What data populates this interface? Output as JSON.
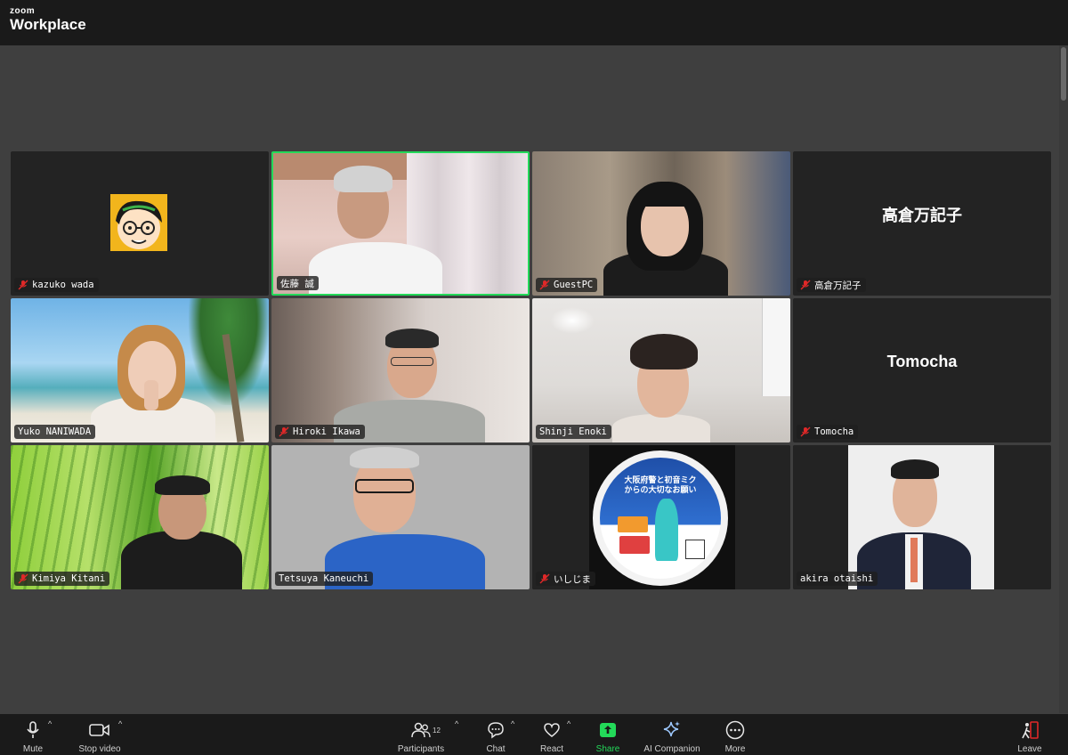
{
  "window": {
    "brand_small": "zoom",
    "brand_big": "Workplace"
  },
  "participants": [
    {
      "name": "kazuko wada",
      "muted": true,
      "video": "avatar"
    },
    {
      "name": "佐藤 誠",
      "muted": false,
      "video": "camera",
      "active_speaker": true
    },
    {
      "name": "GuestPC",
      "muted": true,
      "video": "camera"
    },
    {
      "name": "高倉万記子",
      "muted": true,
      "video": "off"
    },
    {
      "name": "Yuko NANIWADA",
      "muted": false,
      "video": "camera"
    },
    {
      "name": "Hiroki Ikawa",
      "muted": true,
      "video": "camera"
    },
    {
      "name": "Shinji Enoki",
      "muted": false,
      "video": "camera"
    },
    {
      "name": "Tomocha",
      "muted": true,
      "video": "off"
    },
    {
      "name": "Kimiya Kitani",
      "muted": true,
      "video": "camera"
    },
    {
      "name": "Tetsuya Kaneuchi",
      "muted": false,
      "video": "camera"
    },
    {
      "name": "いしじま",
      "muted": true,
      "video": "camera"
    },
    {
      "name": "akira otaishi",
      "muted": false,
      "video": "camera"
    }
  ],
  "poster": {
    "title_line1": "大阪府警と初音ミク",
    "title_line2": "からの大切なお願い"
  },
  "toolbar": {
    "mute": "Mute",
    "stop_video": "Stop video",
    "participants": "Participants",
    "participants_count": "12",
    "chat": "Chat",
    "react": "React",
    "share": "Share",
    "ai_companion": "AI Companion",
    "more": "More",
    "leave": "Leave"
  },
  "colors": {
    "active_speaker_border": "#23d959",
    "share_green": "#23d959",
    "muted_red": "#e02828"
  }
}
